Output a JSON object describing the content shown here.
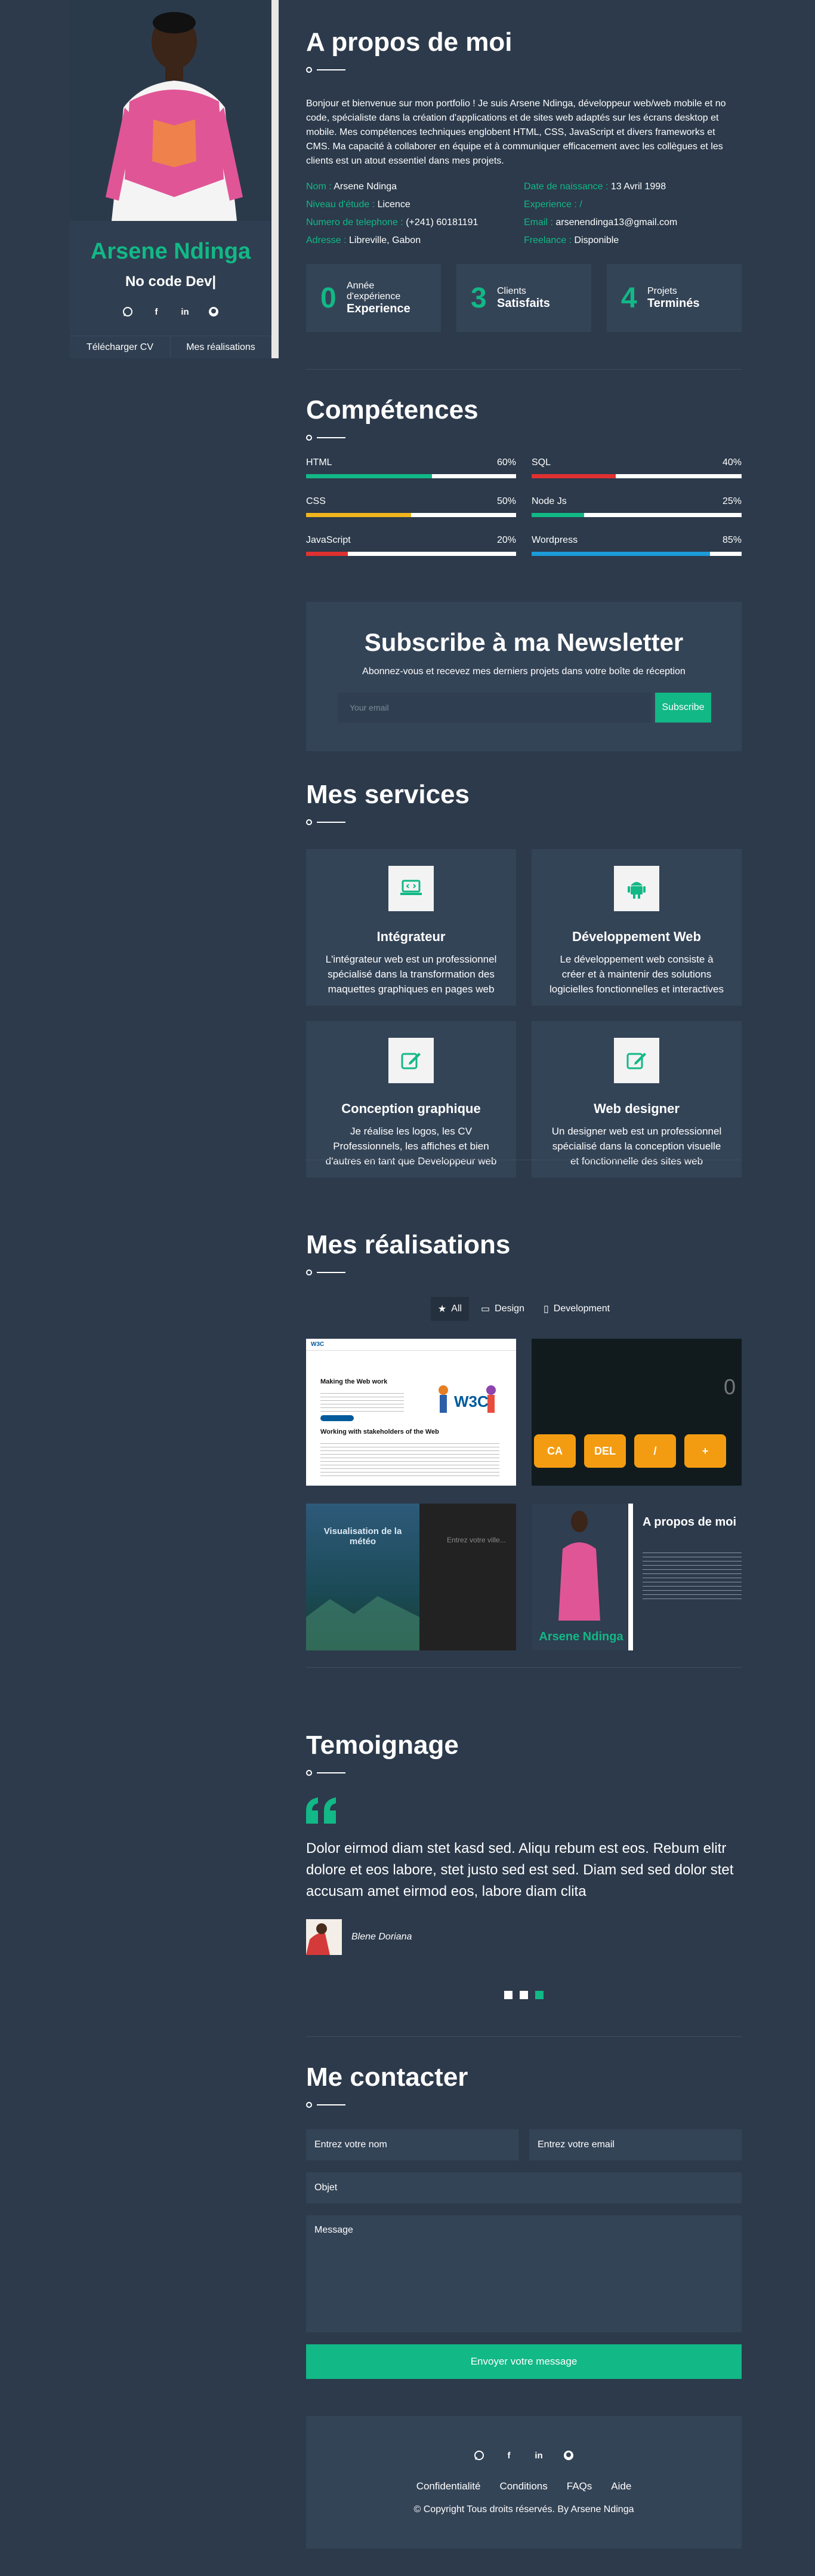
{
  "profile": {
    "name": "Arsene Ndinga",
    "role": "No code Dev|",
    "buttons": [
      "Télécharger CV",
      "Mes réalisations"
    ],
    "socials": [
      "whatsapp-icon",
      "facebook-icon",
      "linkedin-icon",
      "github-icon"
    ]
  },
  "about": {
    "title": "A propos de moi",
    "intro": "Bonjour et bienvenue sur mon portfolio ! Je suis Arsene Ndinga, développeur web/web mobile et no code, spécialiste dans la création d'applications et de sites web adaptés sur les écrans desktop et mobile. Mes compétences techniques englobent HTML, CSS, JavaScript et divers frameworks et CMS. Ma capacité à collaborer en équipe et à communiquer efficacement avec les collègues et les clients est un atout essentiel dans mes projets.",
    "info": [
      {
        "k": "Nom : ",
        "v": "Arsene Ndinga"
      },
      {
        "k": "Date de naissance : ",
        "v": "13 Avril 1998"
      },
      {
        "k": "Niveau d'étude : ",
        "v": "Licence"
      },
      {
        "k": "Experience : /",
        "v": ""
      },
      {
        "k": "Numero de telephone : ",
        "v": "(+241) 60181191"
      },
      {
        "k": "Email : ",
        "v": "arsenendinga13@gmail.com"
      },
      {
        "k": "Adresse : ",
        "v": "Libreville, Gabon"
      },
      {
        "k": "Freelance : ",
        "v": "Disponible"
      }
    ],
    "stats": [
      {
        "n": "0",
        "t1": "Année",
        "t1b": "d'expérience",
        "t2": "Experience"
      },
      {
        "n": "3",
        "t1": "Clients",
        "t1b": "",
        "t2": "Satisfaits"
      },
      {
        "n": "4",
        "t1": "Projets",
        "t1b": "",
        "t2": "Terminés"
      }
    ]
  },
  "skills": {
    "title": "Compétences",
    "items": [
      {
        "name": "HTML",
        "pct": "60%",
        "value": 60,
        "color": "#12b886"
      },
      {
        "name": "SQL",
        "pct": "40%",
        "value": 40,
        "color": "#e03131"
      },
      {
        "name": "CSS",
        "pct": "50%",
        "value": 50,
        "color": "#f1b51d"
      },
      {
        "name": "Node Js",
        "pct": "25%",
        "value": 25,
        "color": "#12b886"
      },
      {
        "name": "JavaScript",
        "pct": "20%",
        "value": 20,
        "color": "#e03131"
      },
      {
        "name": "Wordpress",
        "pct": "85%",
        "value": 85,
        "color": "#1c9bd8"
      }
    ]
  },
  "newsletter": {
    "title": "Subscribe à ma Newsletter",
    "subtitle": "Abonnez-vous et recevez mes derniers projets dans votre boîte de réception",
    "placeholder": "Your email",
    "button": "Subscribe"
  },
  "services": {
    "title": "Mes services",
    "items": [
      {
        "icon": "laptop-code-icon",
        "title": "Intégrateur",
        "desc": "L'intégrateur web est un professionnel spécialisé dans la transformation des maquettes graphiques en pages web"
      },
      {
        "icon": "android-icon",
        "title": "Développement Web",
        "desc": "Le développement web consiste à créer et à maintenir des solutions logicielles fonctionnelles et interactives"
      },
      {
        "icon": "edit-icon",
        "title": "Conception graphique",
        "desc": "Je réalise les logos, les CV Professionnels, les affiches et bien d'autres en tant que Developpeur web"
      },
      {
        "icon": "edit-icon",
        "title": "Web designer",
        "desc": "Un designer web est un professionnel spécialisé dans la conception visuelle et fonctionnelle des sites web"
      }
    ]
  },
  "portfolio": {
    "title": "Mes réalisations",
    "filters": [
      {
        "icon": "star-icon",
        "label": "All"
      },
      {
        "icon": "laptop-icon",
        "label": "Design"
      },
      {
        "icon": "mobile-icon",
        "label": "Development"
      }
    ],
    "calculator": {
      "display": "0",
      "keys": [
        "CA",
        "DEL",
        "/",
        "+"
      ]
    },
    "weather": {
      "title": "Visualisation de la météo",
      "placeholder": "Entrez votre ville..."
    },
    "w3c": {
      "logo": "W3C",
      "heading": "Making the Web work",
      "heading2": "Working with stakeholders of the Web"
    },
    "mini": {
      "title": "A propos de moi",
      "name": "Arsene Ndinga"
    }
  },
  "testimonial": {
    "title": "Temoignage",
    "quote": "Dolor eirmod diam stet kasd sed. Aliqu rebum est eos. Rebum elitr dolore et eos labore, stet justo sed est sed. Diam sed sed dolor stet accusam amet eirmod eos, labore diam clita",
    "author": "Blene Doriana"
  },
  "contact": {
    "title": "Me contacter",
    "name": "Entrez votre nom",
    "email": "Entrez votre email",
    "subject": "Objet",
    "message": "Message",
    "button": "Envoyer votre message"
  },
  "footer": {
    "links": [
      "Confidentialité",
      "Conditions",
      "FAQs",
      "Aide"
    ],
    "copyright": "© Copyright Tous droits réservés. By Arsene Ndinga"
  },
  "colors": {
    "accent": "#12b886",
    "bg": "#2c3a4b",
    "card": "#344457"
  }
}
